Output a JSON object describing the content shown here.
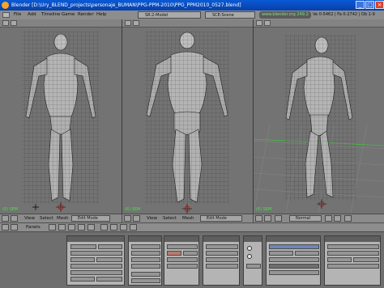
{
  "window": {
    "title": "Blender [D:\\Ury_BLEND_projects\\personaje_BUMAN\\PPG-PPM-2010\\PPG_PPM2010_0527.blend]"
  },
  "menubar": {
    "items": [
      "File",
      "Add",
      "Timeline",
      "Game",
      "Render",
      "Help"
    ],
    "screen": "SR:2-Model",
    "scene": "SCE:Scene",
    "url": "www.blender.org 249.2",
    "stats": "Ve 0-5462 | Fa 0-2742 | Ob 1-9"
  },
  "viewports": {
    "left_label": "(6) SEM",
    "middle_label": "(6) SEM",
    "right_label": "(6) SEM"
  },
  "view_header": {
    "view": "View",
    "select": "Select",
    "mesh": "Mesh",
    "mode": "Edit Mode",
    "right_shading": "Normal"
  },
  "panels_bar": {
    "label": "Panels"
  },
  "colors": {
    "selection_blue": "#0a5ad6",
    "viewport_bg": "#737373",
    "grid_green": "#3fbf3f"
  }
}
